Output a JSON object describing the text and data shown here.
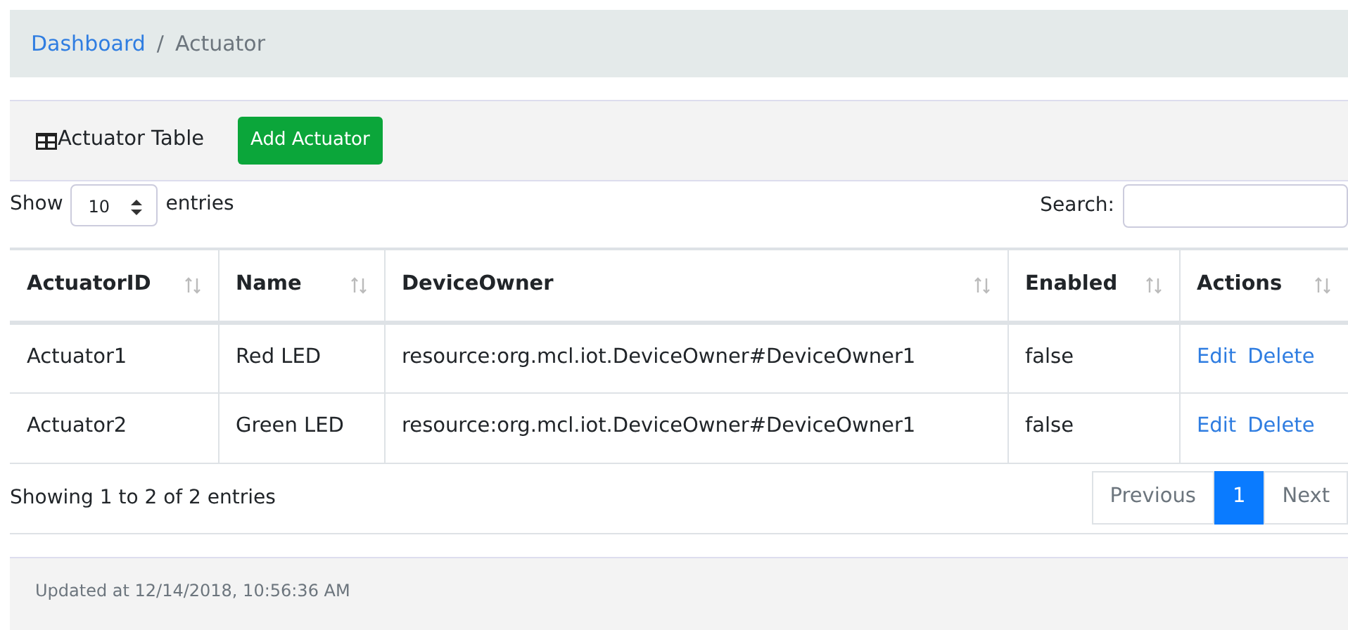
{
  "breadcrumb_separator": "/",
  "breadcrumb": [
    {
      "label": "Dashboard",
      "selected": false
    },
    {
      "label": "Actuator",
      "selected": true
    }
  ],
  "card": {
    "title": "Actuator Table",
    "add_button": "Add Actuator"
  },
  "length": {
    "before": "Show",
    "value": "10",
    "after": "entries"
  },
  "search": {
    "label": "Search:"
  },
  "table": {
    "columns": [
      "ActuatorID",
      "Name",
      "DeviceOwner",
      "Enabled",
      "Actions"
    ],
    "rows": [
      {
        "cells": [
          "Actuator1",
          "Red LED",
          "resource:org.mcl.iot.DeviceOwner#DeviceOwner1",
          "false"
        ],
        "actions": [
          "Edit",
          "Delete"
        ]
      },
      {
        "cells": [
          "Actuator2",
          "Green LED",
          "resource:org.mcl.iot.DeviceOwner#DeviceOwner1",
          "false"
        ],
        "actions": [
          "Edit",
          "Delete"
        ]
      }
    ]
  },
  "info": "Showing 1 to 2 of 2 entries",
  "pagination": [
    {
      "label": "Previous",
      "selected": false
    },
    {
      "label": "1",
      "selected": true
    },
    {
      "label": "Next",
      "selected": false
    }
  ],
  "footer": "Updated at 12/14/2018, 10:56:36 AM"
}
